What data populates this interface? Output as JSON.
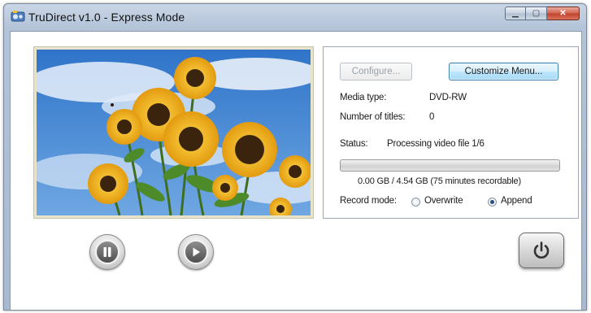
{
  "window": {
    "title": "TruDirect v1.0 - Express Mode"
  },
  "panel": {
    "configure_label": "Configure...",
    "customize_label": "Customize Menu...",
    "media_type_label": "Media type:",
    "media_type_value": "DVD-RW",
    "titles_label": "Number of titles:",
    "titles_value": "0",
    "status_label": "Status:",
    "status_value": "Processing video file 1/6",
    "progress": 0.0,
    "capacity_text": "0.00 GB / 4.54 GB (75 minutes recordable)",
    "record_mode_label": "Record mode:",
    "record_mode_options": [
      "Overwrite",
      "Append"
    ],
    "record_mode_selected": "Append"
  },
  "controls": {
    "pause_icon": "pause-icon",
    "play_icon": "play-icon",
    "power_icon": "power-icon"
  },
  "colors": {
    "accent_button": "#bee6fd",
    "progress_fill": "#22a817",
    "sky": "#3d86d6"
  }
}
